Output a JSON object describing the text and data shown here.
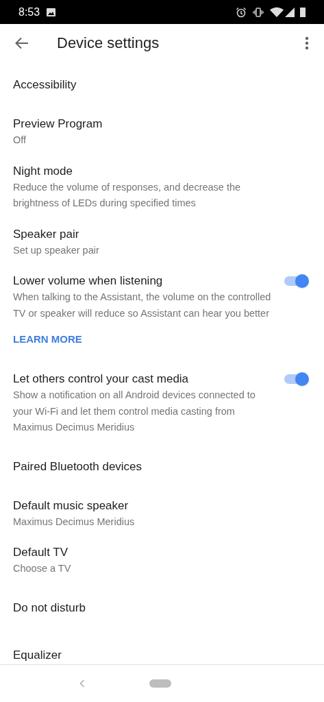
{
  "status_bar": {
    "time": "8:53"
  },
  "app_bar": {
    "title": "Device settings"
  },
  "settings": [
    {
      "kind": "setting",
      "title": "Accessibility"
    },
    {
      "kind": "setting",
      "title": "Preview Program",
      "subtitle": "Off"
    },
    {
      "kind": "setting",
      "title": "Night mode",
      "subtitle": "Reduce the volume of responses, and decrease the brightness of LEDs during specified times"
    },
    {
      "kind": "setting",
      "title": "Speaker pair",
      "subtitle": "Set up speaker pair"
    },
    {
      "kind": "setting",
      "title": "Lower volume when listening",
      "subtitle": "When talking to the Assistant, the volume on the controlled TV or speaker will reduce so Assistant can hear you better",
      "toggle": {
        "on": true
      }
    },
    {
      "kind": "link",
      "title": "LEARN MORE"
    },
    {
      "kind": "setting",
      "title": "Let others control your cast media",
      "subtitle": "Show a notification on all Android devices connected to your Wi-Fi and let them control media casting from Maximus Decimus Meridius",
      "toggle": {
        "on": true
      }
    },
    {
      "kind": "setting",
      "title": "Paired Bluetooth devices"
    },
    {
      "kind": "setting",
      "title": "Default music speaker",
      "subtitle": "Maximus Decimus Meridius"
    },
    {
      "kind": "setting",
      "title": "Default TV",
      "subtitle": "Choose a TV"
    },
    {
      "kind": "setting",
      "title": "Do not disturb"
    },
    {
      "kind": "setting",
      "title": "Equalizer"
    }
  ]
}
